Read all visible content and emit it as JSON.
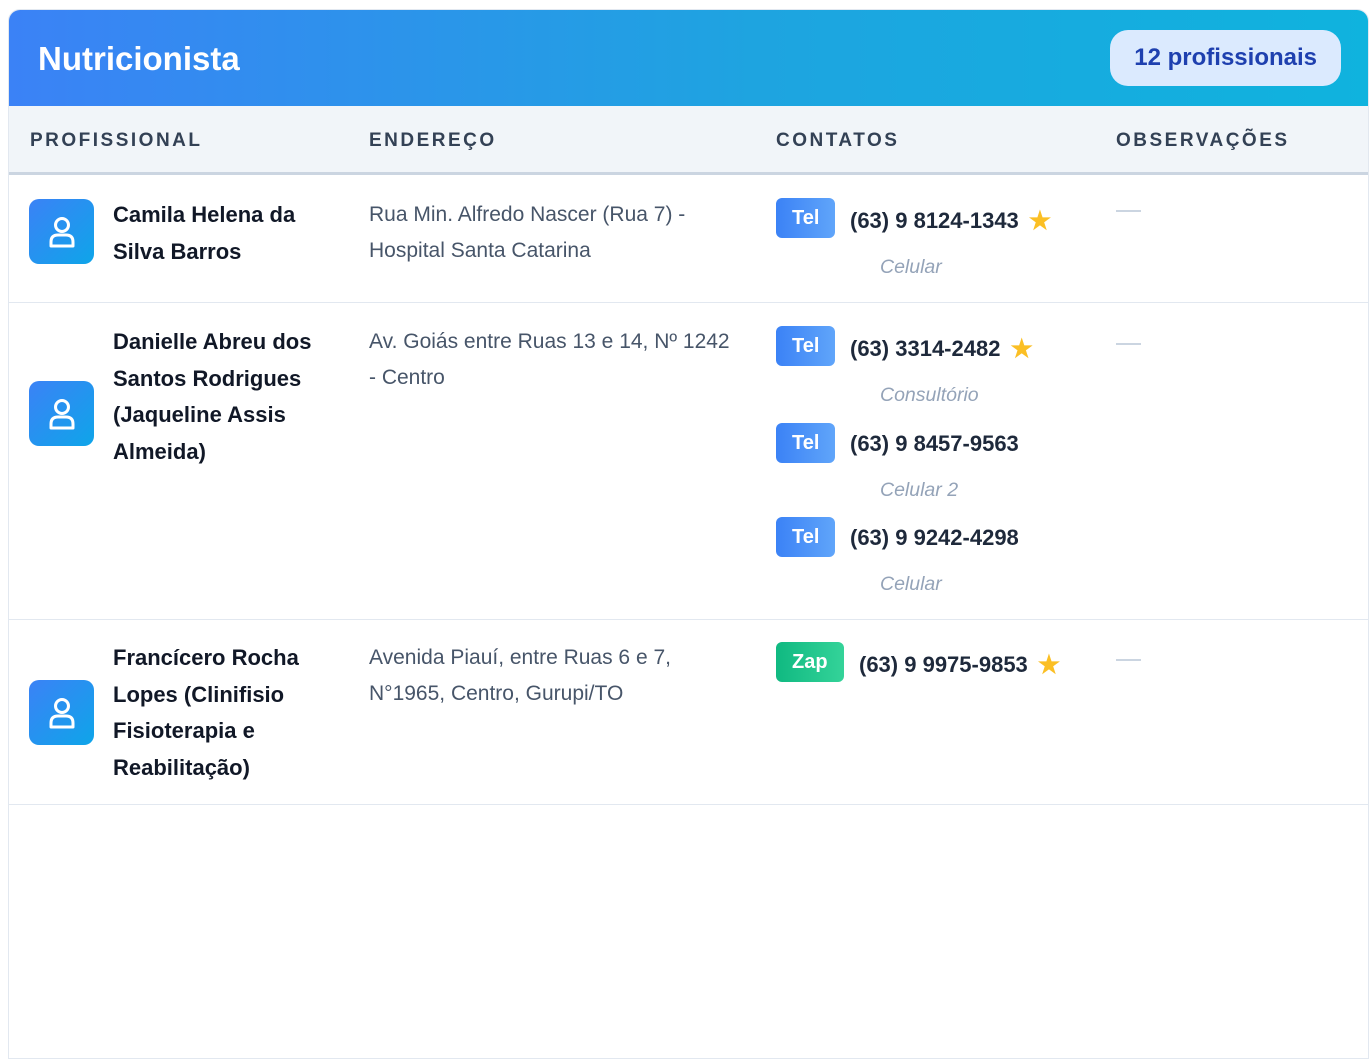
{
  "header": {
    "title": "Nutricionista",
    "count": "12 profissionais"
  },
  "columns": {
    "professional": "PROFISSIONAL",
    "address": "ENDEREÇO",
    "contacts": "CONTATOS",
    "notes": "OBSERVAÇÕES"
  },
  "rows": [
    {
      "name": "Camila Helena da Silva Barros",
      "address": "Rua Min. Alfredo Nascer (Rua 7) - Hospital Santa Catarina",
      "contacts": [
        {
          "type": "Tel",
          "number": "(63) 9 8124-1343",
          "star": "★",
          "label": "Celular"
        }
      ],
      "notes": "—"
    },
    {
      "name": "Danielle Abreu dos Santos Rodrigues (Jaqueline Assis Almeida)",
      "address": "Av. Goiás entre Ruas 13 e 14, Nº 1242 - Centro",
      "contacts": [
        {
          "type": "Tel",
          "number": "(63) 3314-2482",
          "star": "★",
          "label": "Consultório"
        },
        {
          "type": "Tel",
          "number": "(63) 9 8457-9563",
          "label": "Celular 2"
        },
        {
          "type": "Tel",
          "number": "(63) 9 9242-4298",
          "label": "Celular"
        }
      ],
      "notes": "—"
    },
    {
      "name": "Francícero Rocha Lopes (Clinifisio Fisioterapia e Reabilitação)",
      "address": "Avenida Piauí, entre Ruas 6 e 7, N°1965, Centro, Gurupi/TO",
      "contacts": [
        {
          "type": "Zap",
          "number": "(63) 9 9975-9853",
          "star": "★"
        }
      ],
      "notes": "—"
    }
  ],
  "icons": {
    "avatar": "user-icon",
    "favorite": "star-icon"
  },
  "colors": {
    "header_start": "#3b82f6",
    "header_end": "#0fb3de",
    "tel_tag": "#3b82f6",
    "zap_tag": "#10b981",
    "star": "#fbbf24"
  }
}
